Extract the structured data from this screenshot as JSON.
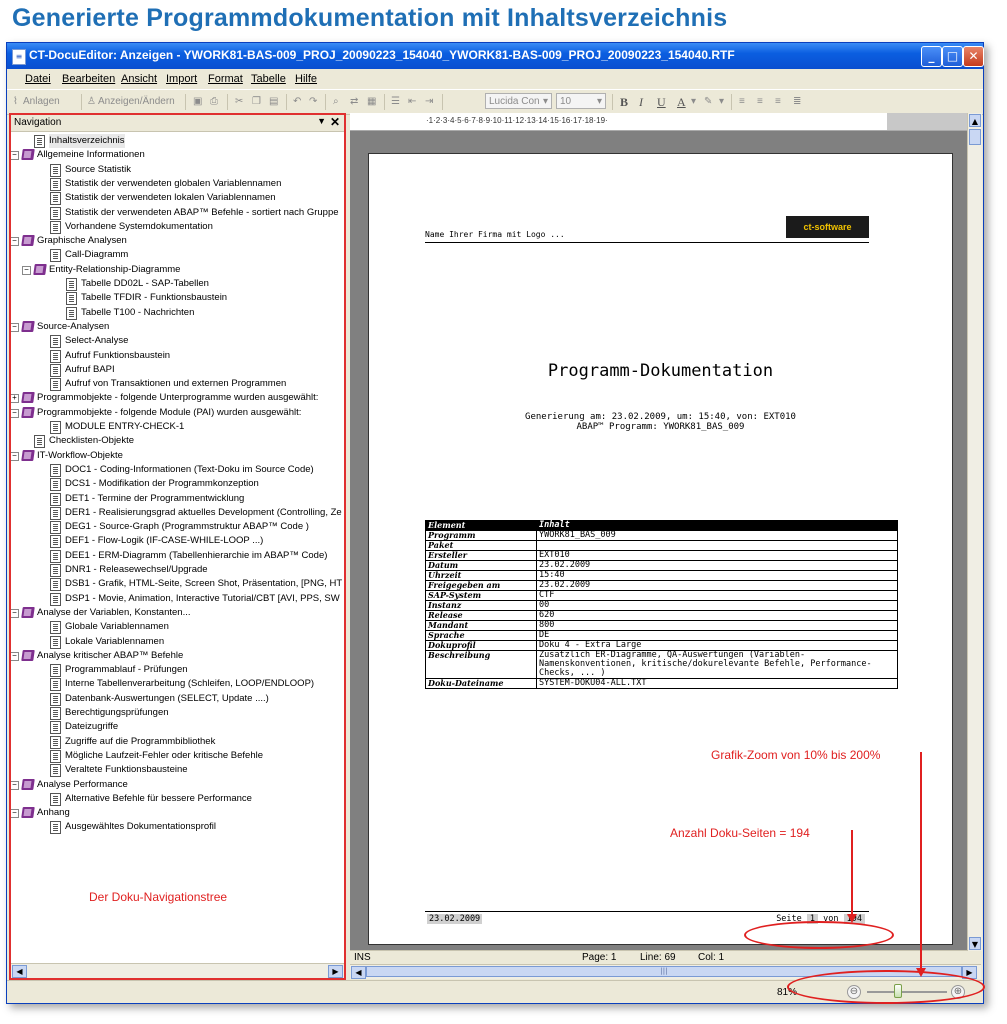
{
  "heading": "Generierte Programmdokumentation mit Inhaltsverzeichnis",
  "window": {
    "title": "CT-DocuEditor: Anzeigen - YWORK81-BAS-009_PROJ_20090223_154040_YWORK81-BAS-009_PROJ_20090223_154040.RTF",
    "buttons": {
      "minimize": "_",
      "maximize": "□",
      "close": "✕"
    }
  },
  "menu": [
    "Datei",
    "Bearbeiten",
    "Ansicht",
    "Import",
    "Format",
    "Tabelle",
    "Hilfe"
  ],
  "toolbar": {
    "anlagen": "Anlagen",
    "anzeigen": "Anzeigen/Ändern",
    "font": "Lucida Con",
    "size": "10",
    "bold": "B",
    "italic": "I",
    "underline": "U",
    "fontcolor": "A"
  },
  "nav": {
    "title": "Navigation",
    "pin": "▼",
    "close": "✕",
    "note": "Der Doku-Navigationstree",
    "items": [
      {
        "label": "Inhaltsverzeichnis",
        "type": "doc",
        "level": 1,
        "exp": ""
      },
      {
        "label": "Allgemeine Informationen",
        "type": "book",
        "level": 0,
        "exp": "-"
      },
      {
        "label": "Source Statistik",
        "type": "doc",
        "level": 2,
        "exp": ""
      },
      {
        "label": "Statistik der verwendeten globalen Variablennamen",
        "type": "doc",
        "level": 2,
        "exp": ""
      },
      {
        "label": "Statistik der verwendeten lokalen Variablennamen",
        "type": "doc",
        "level": 2,
        "exp": ""
      },
      {
        "label": "Statistik der verwendeten ABAP™ Befehle - sortiert nach Gruppe",
        "type": "doc",
        "level": 2,
        "exp": ""
      },
      {
        "label": "Vorhandene Systemdokumentation",
        "type": "doc",
        "level": 2,
        "exp": ""
      },
      {
        "label": "Graphische Analysen",
        "type": "book",
        "level": 0,
        "exp": "-"
      },
      {
        "label": "Call-Diagramm",
        "type": "doc",
        "level": 2,
        "exp": ""
      },
      {
        "label": "Entity-Relationship-Diagramme",
        "type": "book",
        "level": 1,
        "exp": "-"
      },
      {
        "label": "Tabelle DD02L - SAP-Tabellen",
        "type": "doc",
        "level": 3,
        "exp": ""
      },
      {
        "label": "Tabelle TFDIR - Funktionsbaustein",
        "type": "doc",
        "level": 3,
        "exp": ""
      },
      {
        "label": "Tabelle T100 - Nachrichten",
        "type": "doc",
        "level": 3,
        "exp": ""
      },
      {
        "label": "Source-Analysen",
        "type": "book",
        "level": 0,
        "exp": "-"
      },
      {
        "label": "Select-Analyse",
        "type": "doc",
        "level": 2,
        "exp": ""
      },
      {
        "label": "Aufruf Funktionsbaustein",
        "type": "doc",
        "level": 2,
        "exp": ""
      },
      {
        "label": "Aufruf BAPI",
        "type": "doc",
        "level": 2,
        "exp": ""
      },
      {
        "label": "Aufruf von Transaktionen und externen Programmen",
        "type": "doc",
        "level": 2,
        "exp": ""
      },
      {
        "label": "Programmobjekte - folgende Unterprogramme wurden ausgewählt:",
        "type": "book",
        "level": 0,
        "exp": "+"
      },
      {
        "label": "Programmobjekte - folgende Module (PAI) wurden ausgewählt:",
        "type": "book",
        "level": 0,
        "exp": "-"
      },
      {
        "label": "MODULE ENTRY-CHECK-1",
        "type": "doc",
        "level": 2,
        "exp": ""
      },
      {
        "label": "Checklisten-Objekte",
        "type": "doc",
        "level": 1,
        "exp": ""
      },
      {
        "label": "IT-Workflow-Objekte",
        "type": "book",
        "level": 0,
        "exp": "-"
      },
      {
        "label": "DOC1 - Coding-Informationen (Text-Doku im Source Code)",
        "type": "doc",
        "level": 2,
        "exp": ""
      },
      {
        "label": "DCS1 - Modifikation der Programmkonzeption",
        "type": "doc",
        "level": 2,
        "exp": ""
      },
      {
        "label": "DET1 - Termine der Programmentwicklung",
        "type": "doc",
        "level": 2,
        "exp": ""
      },
      {
        "label": "DER1 - Realisierungsgrad aktuelles Development (Controlling, Ze",
        "type": "doc",
        "level": 2,
        "exp": ""
      },
      {
        "label": "DEG1 - Source-Graph (Programmstruktur ABAP™ Code )",
        "type": "doc",
        "level": 2,
        "exp": ""
      },
      {
        "label": "DEF1 - Flow-Logik (IF-CASE-WHILE-LOOP ...)",
        "type": "doc",
        "level": 2,
        "exp": ""
      },
      {
        "label": "DEE1 - ERM-Diagramm (Tabellenhierarchie im ABAP™ Code)",
        "type": "doc",
        "level": 2,
        "exp": ""
      },
      {
        "label": "DNR1 - Releasewechsel/Upgrade",
        "type": "doc",
        "level": 2,
        "exp": ""
      },
      {
        "label": "DSB1 - Grafik, HTML-Seite, Screen Shot, Präsentation, [PNG, HT",
        "type": "doc",
        "level": 2,
        "exp": ""
      },
      {
        "label": "DSP1 - Movie, Animation, Interactive Tutorial/CBT [AVI, PPS, SW",
        "type": "doc",
        "level": 2,
        "exp": ""
      },
      {
        "label": "Analyse der Variablen, Konstanten...",
        "type": "book",
        "level": 0,
        "exp": "-"
      },
      {
        "label": "Globale Variablennamen",
        "type": "doc",
        "level": 2,
        "exp": ""
      },
      {
        "label": "Lokale Variablennamen",
        "type": "doc",
        "level": 2,
        "exp": ""
      },
      {
        "label": "Analyse kritischer ABAP™ Befehle",
        "type": "book",
        "level": 0,
        "exp": "-"
      },
      {
        "label": "Programmablauf - Prüfungen",
        "type": "doc",
        "level": 2,
        "exp": ""
      },
      {
        "label": "Interne Tabellenverarbeitung (Schleifen, LOOP/ENDLOOP)",
        "type": "doc",
        "level": 2,
        "exp": ""
      },
      {
        "label": "Datenbank-Auswertungen (SELECT, Update ....)",
        "type": "doc",
        "level": 2,
        "exp": ""
      },
      {
        "label": "Berechtigungsprüfungen",
        "type": "doc",
        "level": 2,
        "exp": ""
      },
      {
        "label": "Dateizugriffe",
        "type": "doc",
        "level": 2,
        "exp": ""
      },
      {
        "label": "Zugriffe auf die Programmbibliothek",
        "type": "doc",
        "level": 2,
        "exp": ""
      },
      {
        "label": "Mögliche Laufzeit-Fehler oder kritische Befehle",
        "type": "doc",
        "level": 2,
        "exp": ""
      },
      {
        "label": "Veraltete Funktionsbausteine",
        "type": "doc",
        "level": 2,
        "exp": ""
      },
      {
        "label": "Analyse Performance",
        "type": "book",
        "level": 0,
        "exp": "-"
      },
      {
        "label": "Alternative Befehle für bessere Performance",
        "type": "doc",
        "level": 2,
        "exp": ""
      },
      {
        "label": "Anhang",
        "type": "book",
        "level": 0,
        "exp": "-"
      },
      {
        "label": "Ausgewähltes Dokumentationsprofil",
        "type": "doc",
        "level": 2,
        "exp": ""
      }
    ]
  },
  "ruler": "·1·2·3·4·5·6·7·8·9·10·11·12·13·14·15·16·17·18·19·",
  "document": {
    "firm": "Name Ihrer Firma mit Logo ...",
    "logo": "ct-software",
    "title": "Programm-Dokumentation",
    "gen1": "Generierung am: 23.02.2009, um: 15:40, von: EXT010",
    "gen2": "ABAP™ Programm: YWORK81_BAS_009",
    "table_head": [
      "Element",
      "Inhalt"
    ],
    "rows": [
      [
        "Programm",
        "YWORK81_BAS_009"
      ],
      [
        "Paket",
        ""
      ],
      [
        "Ersteller",
        "EXT010"
      ],
      [
        "Datum",
        "23.02.2009"
      ],
      [
        "Uhrzeit",
        "15:40"
      ],
      [
        "Freigegeben am",
        "23.02.2009"
      ],
      [
        "SAP-System",
        "CTF"
      ],
      [
        "Instanz",
        "00"
      ],
      [
        "Release",
        "620"
      ],
      [
        "Mandant",
        "800"
      ],
      [
        "Sprache",
        "DE"
      ],
      [
        "Dokuprofil",
        "Doku 4 - Extra Large"
      ],
      [
        "Beschreibung",
        "Zusätzlich ER-Diagramme, QA-Auswertungen (Variablen-Namenskonventionen, kritische/dokurelevante Befehle, Performance-Checks, ... )"
      ],
      [
        "Doku-Dateiname",
        "SYSTEM-DOKU04-ALL.TXT"
      ]
    ],
    "footer_date": "23.02.2009",
    "footer_page_label": "Seite",
    "footer_page": "1",
    "footer_of": "von",
    "footer_total": "194"
  },
  "status": {
    "ins": "INS",
    "page": "Page: 1",
    "line": "Line: 69",
    "col": "Col: 1"
  },
  "zoom": {
    "value": "81%",
    "minus": "⊖",
    "plus": "⊕",
    "level_percent": 81
  },
  "annotations": {
    "zoom": "Grafik-Zoom von 10% bis 200%",
    "pages": "Anzahl Doku-Seiten  =  194"
  }
}
